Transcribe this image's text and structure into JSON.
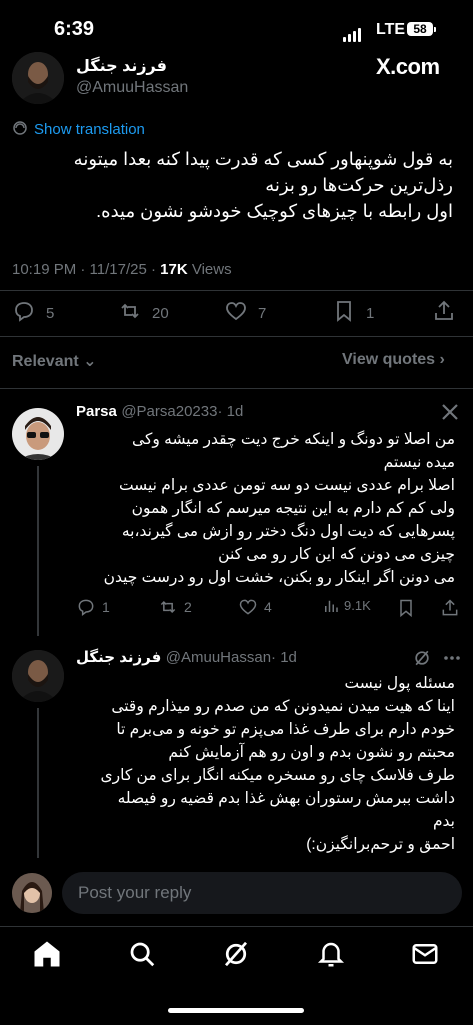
{
  "status_bar": {
    "time": "6:39",
    "network": "LTE",
    "battery": "58"
  },
  "main_tweet": {
    "author_name": "فرزند جنگل",
    "author_handle": "@AmuuHassan",
    "brand": "X.com",
    "translate_label": "Show translation",
    "text_lines": [
      "به قول شوپنهاور کسی که قدرت پیدا کنه بعدا میتونه",
      "رذل‌ترین حرکت‌ها رو بزنه",
      "اول رابطه با چیزهای کوچیک خودشو نشون میده."
    ],
    "time": "10:19 PM · 11/17/25 · ",
    "views_count": "17K",
    "views_label": " Views",
    "stats": {
      "replies": "5",
      "reposts": "20",
      "likes": "7",
      "bookmarks": "1"
    }
  },
  "sort": {
    "label": "Relevant",
    "view_quotes": "View quotes"
  },
  "replies": [
    {
      "name": "Parsa",
      "handle": "@Parsa20233",
      "age": "· 1d",
      "text_lines": [
        "من اصلا تو دونگ و اینکه خرج دیت چقدر میشه وکی",
        "میده نیستم",
        "اصلا برام عددی نیست دو سه تومن عددی برام نیست",
        "ولی کم کم دارم به این نتیجه میرسم که انگار همون",
        "پسرهایی که دیت اول دنگ دختر رو ازش می گیرند،به",
        "چیزی می دونن که این کار رو می کنن",
        "می دونن اگر اینکار رو بکنن، خشت اول رو درست چیدن"
      ],
      "stats": {
        "replies": "1",
        "reposts": "2",
        "likes": "4",
        "views": "9.1K"
      }
    },
    {
      "name": "فرزند جنگل",
      "handle": "@AmuuHassan",
      "age": "· 1d",
      "text_lines": [
        "مسئله پول نیست",
        "اینا که هیت میدن نمیدونن که من صدم رو میذارم وقتی",
        "خودم دارم برای طرف غذا می‌پزم تو خونه و می‌برم تا",
        "محبتم رو نشون بدم و اون رو هم آزمایش کنم",
        "طرف فلاسک چای رو مسخره میکنه انگار برای من کاری",
        "داشت ببرمش رستوران بهش غذا بدم قضیه  رو فیصله",
        "بدم",
        "احمق و ترحم‌برانگیزن:)"
      ]
    }
  ],
  "composer": {
    "placeholder": "Post your reply"
  },
  "nav": [
    "home-icon",
    "search-icon",
    "grok-icon",
    "notifications-icon",
    "messages-icon"
  ],
  "colors": {
    "accent": "#1d9bf0",
    "muted": "#71767b",
    "background": "#000000"
  }
}
